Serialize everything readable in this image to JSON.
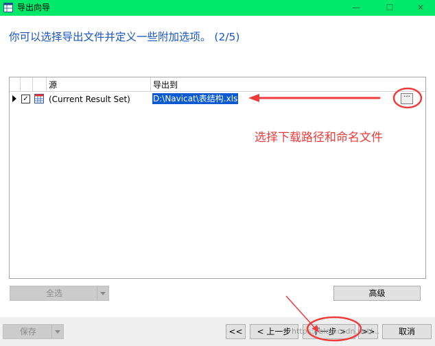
{
  "window": {
    "title": "导出向导",
    "minimize": "—",
    "maximize": "☐",
    "close": "✕"
  },
  "instruction": "你可以选择导出文件并定义一些附加选项。 (2/5)",
  "grid": {
    "columns": [
      "源",
      "导出到"
    ],
    "rows": [
      {
        "checked": true,
        "source": "(Current Result Set)",
        "destination": "D:\\Navicat\\表结构.xls"
      }
    ]
  },
  "browse_label": "···",
  "annotation": "选择下载路径和命名文件",
  "buttons": {
    "select_all": "全选",
    "advanced": "高级",
    "save": "保存",
    "first": "<<",
    "prev": "< 上一步",
    "next": "下一步 >",
    "last": ">>",
    "cancel": "取消"
  },
  "watermark": "https://blog.csdn.net/...",
  "colors": {
    "titlebar": "#00e86a",
    "instruction": "#1a55c6",
    "annotation": "#f03b3b",
    "selection": "#0a5bd3"
  }
}
